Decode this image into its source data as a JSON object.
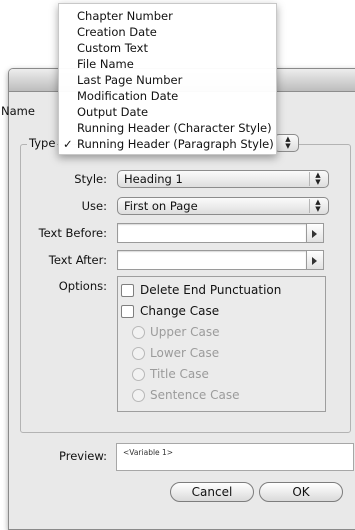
{
  "menu": {
    "items": [
      {
        "label": "Chapter Number",
        "checked": false
      },
      {
        "label": "Creation Date",
        "checked": false
      },
      {
        "label": "Custom Text",
        "checked": false
      },
      {
        "label": "File Name",
        "checked": false
      },
      {
        "label": "Last Page Number",
        "checked": false
      },
      {
        "label": "Modification Date",
        "checked": false
      },
      {
        "label": "Output Date",
        "checked": false
      },
      {
        "label": "Running Header (Character Style)",
        "checked": false
      },
      {
        "label": "Running Header (Paragraph Style)",
        "checked": true
      }
    ],
    "check_mark": "✓"
  },
  "dialog": {
    "name_label": "Name",
    "type_label": "Type",
    "style": {
      "label": "Style:",
      "value": "Heading 1"
    },
    "use": {
      "label": "Use:",
      "value": "First on Page"
    },
    "text_before": {
      "label": "Text Before:",
      "value": ""
    },
    "text_after": {
      "label": "Text After:",
      "value": ""
    },
    "options": {
      "label": "Options:",
      "delete_end_punctuation": "Delete End Punctuation",
      "change_case": "Change Case",
      "radios": [
        "Upper Case",
        "Lower Case",
        "Title Case",
        "Sentence Case"
      ]
    },
    "preview": {
      "label": "Preview:",
      "value": "<Variable 1>"
    },
    "buttons": {
      "cancel": "Cancel",
      "ok": "OK"
    }
  },
  "icons": {
    "popup_arrows": "updown-arrows-icon",
    "insert_triangle": "right-triangle-icon",
    "check": "checkmark-icon"
  }
}
